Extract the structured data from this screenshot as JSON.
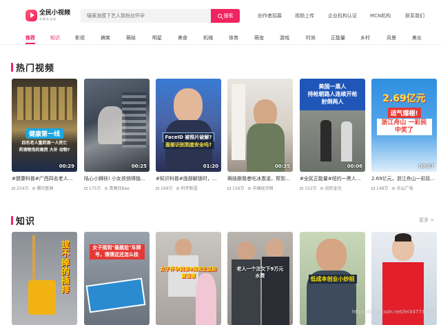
{
  "logo": {
    "title": "全民小视频",
    "subtitle": "有趣有温度"
  },
  "search": {
    "placeholder": "嘬黄渤摸下艺人致粉丝怀孕",
    "button": "搜索"
  },
  "top_links": [
    "创作者招募",
    "视频上传",
    "企业机构认证",
    "MCN机构",
    "联系我们"
  ],
  "categories": [
    "推荐",
    "知识",
    "影视",
    "搞笑",
    "萌娃",
    "明星",
    "美食",
    "机械",
    "体育",
    "萌宠",
    "游戏",
    "时尚",
    "正能量",
    "乡村",
    "风景",
    "美女"
  ],
  "sections": {
    "hot": {
      "title": "热门视频"
    },
    "knowledge": {
      "title": "知识",
      "more": "更多 >"
    }
  },
  "hot_videos": [
    {
      "title": "#健康科普#广西四名老人...",
      "views": "254万",
      "author": "腾讯医典",
      "duration": "00:29",
      "overlay": "健康第一线",
      "overlay2": "四名老人重药酒一人死亡",
      "overlay3": "药酒物泡的竟然 大补 动物?"
    },
    {
      "title": "陆心小狮袄! 小女孩俏得独...",
      "views": "175万",
      "author": "青晚侦Bee",
      "duration": "00:25",
      "overlay": "",
      "overlay2": "",
      "overlay3": ""
    },
    {
      "title": "#知识科普#面部解锁时，...",
      "views": "169万",
      "author": "科学新语",
      "duration": "01:20",
      "overlay": "FaceID 被照片破解?",
      "overlay2": "面部识别到底安全吗?",
      "overlay3": ""
    },
    {
      "title": "萌娃跟我者吃冰激凌，帮到...",
      "views": "156万",
      "author": "中国经济网",
      "duration": "00:35",
      "overlay": "",
      "overlay2": "",
      "overlay3": ""
    },
    {
      "title": "#全民正能量#纽约一黑人...",
      "views": "152万",
      "author": "创民金讯",
      "duration": "00:06",
      "overlay": "美国一黑人",
      "overlay2": "持枪朝路人连续开枪",
      "overlay3": "射倒两人"
    },
    {
      "title": "2.69亿元，浙江舟山一彩民...",
      "views": "148万",
      "author": "舟山广电",
      "duration": "00:07",
      "overlay": "2.69亿元",
      "overlay2": "运气爆棚!",
      "overlay3": "浙江舟山 一彩民中奖了"
    }
  ],
  "knowledge_videos": [
    {
      "overlay": "拔不掉的插排"
    },
    {
      "overlay": "女子摇到\"最尴尬\"车牌号，猜猜这还怎么挂"
    },
    {
      "overlay": "女子怀孕到第8周发生这些要留意"
    },
    {
      "overlay": "老人一个注欠下9万元水费"
    },
    {
      "overlay": "低成本创业小妙招"
    },
    {
      "overlay": ""
    }
  ],
  "watermark": "https://blog.csdn.net/lei347735794",
  "colors": {
    "accent": "#f0245f"
  }
}
